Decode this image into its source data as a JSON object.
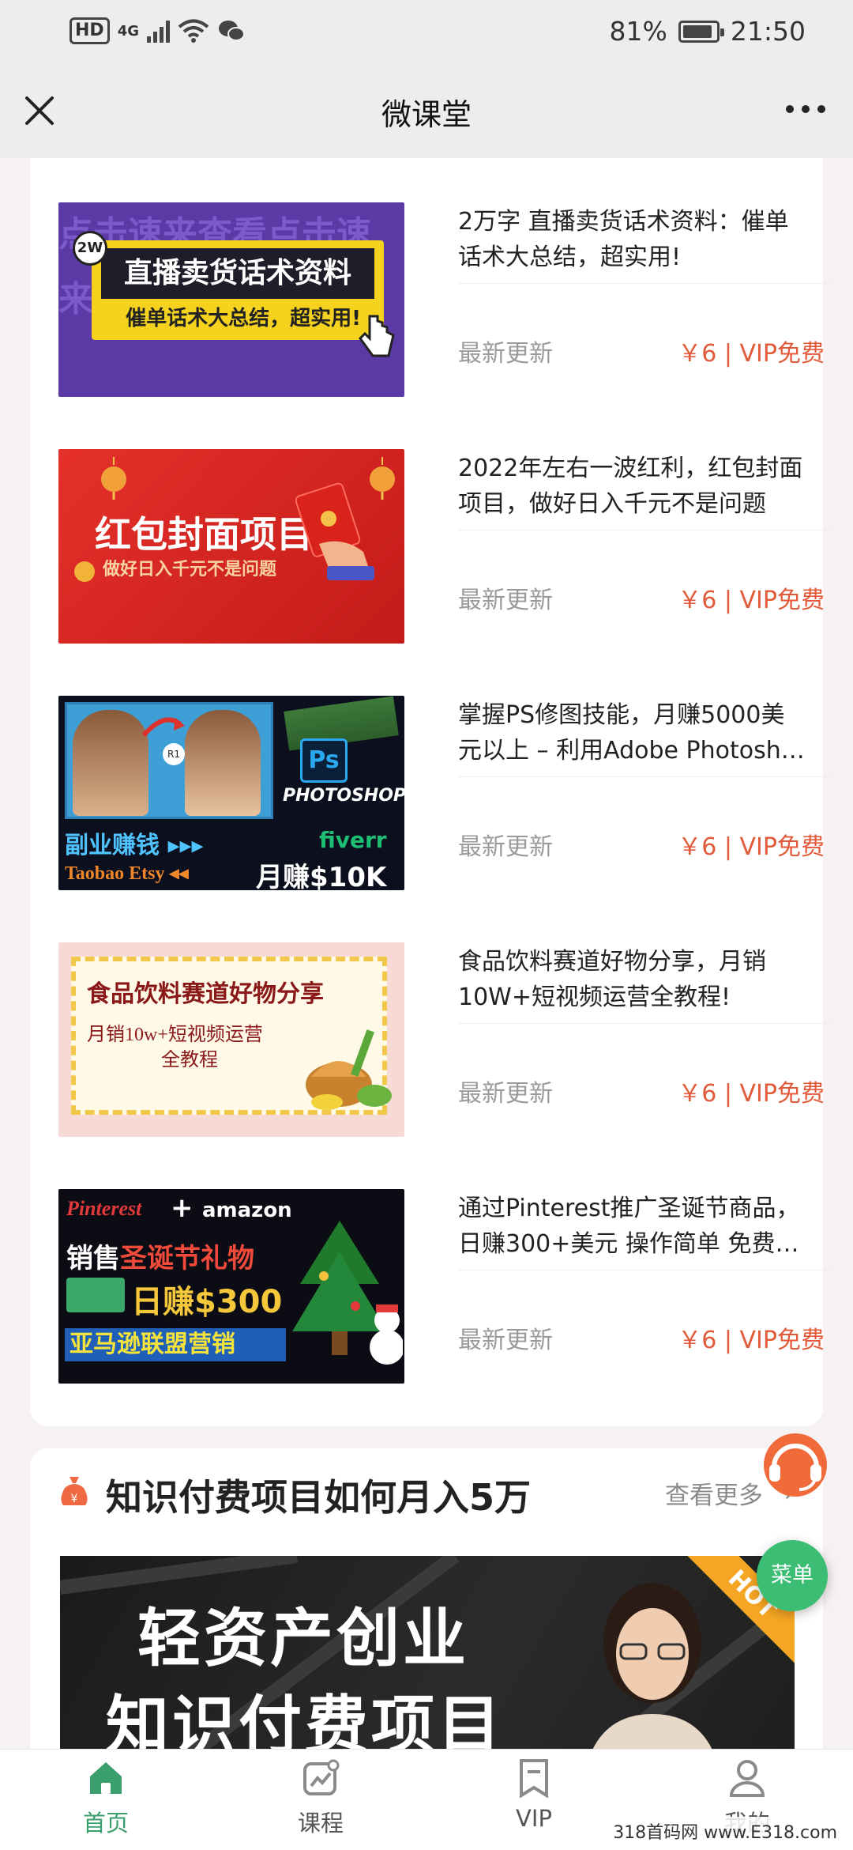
{
  "status_bar": {
    "hd": "HD",
    "network": "4G",
    "battery_pct": "81%",
    "time": "21:50"
  },
  "nav": {
    "title": "微课堂"
  },
  "latest": {
    "items": [
      {
        "title": "2万字 直播卖货话术资料：催单话术大总结，超实用!",
        "meta": "最新更新",
        "price": "￥6 | VIP免费",
        "thumb": {
          "badge": "2W",
          "headline": "直播卖货话术资料",
          "sub": "催单话术大总结，超实用!",
          "bg_text": "点击速来查看点击速来查看"
        }
      },
      {
        "title": "2022年左右一波红利，红包封面项目，做好日入千元不是问题",
        "meta": "最新更新",
        "price": "￥6 | VIP免费",
        "thumb": {
          "headline": "红包封面项目",
          "sub": "做好日入千元不是问题"
        }
      },
      {
        "title": "掌握PS修图技能，月赚5000美元以上 – 利用Adobe Photosh…",
        "meta": "最新更新",
        "price": "￥6 | VIP免费",
        "thumb": {
          "badge": "R1",
          "ps": "Ps",
          "ps_brand": "PHOTOSHOP",
          "line1": "副业赚钱 ▸▸▸",
          "brand": "fiverr",
          "line2a": "Taobao Etsy ◂◂",
          "line2b": "月赚$10K"
        }
      },
      {
        "title": "食品饮料赛道好物分享，月销10W+短视频运营全教程!",
        "meta": "最新更新",
        "price": "￥6 | VIP免费",
        "thumb": {
          "headline": "食品饮料赛道好物分享",
          "sub1": "月销10w+短视频运营",
          "sub2": "全教程"
        }
      },
      {
        "title": "通过Pinterest推广圣诞节商品，日赚300+美元 操作简单 免费…",
        "meta": "最新更新",
        "price": "￥6 | VIP免费",
        "thumb": {
          "brand1": "Pinterest",
          "plus": "+",
          "brand2": "amazon",
          "l1a": "销售",
          "l1b": "圣诞节礼物",
          "l2": "日赚$300",
          "l3": "亚马逊联盟营销"
        }
      }
    ]
  },
  "section2": {
    "title": "知识付费项目如何月入5万",
    "more": "查看更多",
    "banner": {
      "line1": "轻资产创业",
      "line2": "知识付费项目",
      "tag": "HOT"
    }
  },
  "float_menu": {
    "label": "菜单"
  },
  "tabs": [
    {
      "label": "首页",
      "icon": "home-icon",
      "active": true
    },
    {
      "label": "课程",
      "icon": "chart-icon",
      "active": false
    },
    {
      "label": "VIP",
      "icon": "bookmark-icon",
      "active": false
    },
    {
      "label": "我的",
      "icon": "user-icon",
      "active": false
    }
  ],
  "watermark": "318首码网 www.E318.com",
  "colors": {
    "accent": "#3a9e6d",
    "price": "#e15a3a",
    "menu": "#3bbd74"
  }
}
